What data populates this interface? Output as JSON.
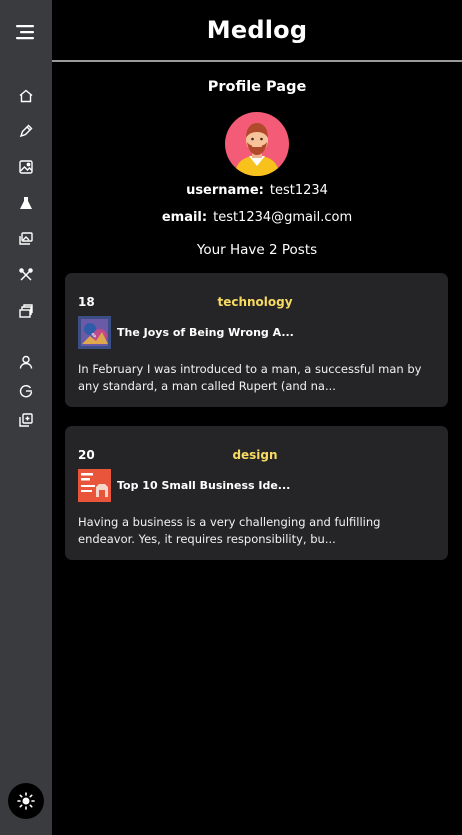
{
  "header": {
    "title": "Medlog"
  },
  "sidebar": {
    "icons": [
      "menu-icon",
      "home-icon",
      "pen-icon",
      "image-icon",
      "flask-icon",
      "gallery-icon",
      "tools-icon",
      "books-icon",
      "user-icon",
      "logout-icon",
      "copy-icon"
    ],
    "theme_icon": "sun-icon",
    "bg_color": "#3a3b3f"
  },
  "profile": {
    "page_title": "Profile Page",
    "username_label": "username:",
    "username": "test1234",
    "email_label": "email:",
    "email": "test1234@gmail.com",
    "posts_count_text": "Your Have 2 Posts"
  },
  "posts": [
    {
      "id": "18",
      "category": "technology",
      "title": "The Joys of Being Wrong A...",
      "excerpt": "In February I was introduced to a man, a successful man by any standard, a man called Rupert (and na..."
    },
    {
      "id": "20",
      "category": "design",
      "title": "Top 10 Small Business Ide...",
      "excerpt": "Having a business is a very challenging and fulfilling endeavor. Yes, it requires responsibility, bu..."
    }
  ],
  "colors": {
    "accent": "#f7da61",
    "card_bg": "#252527"
  }
}
